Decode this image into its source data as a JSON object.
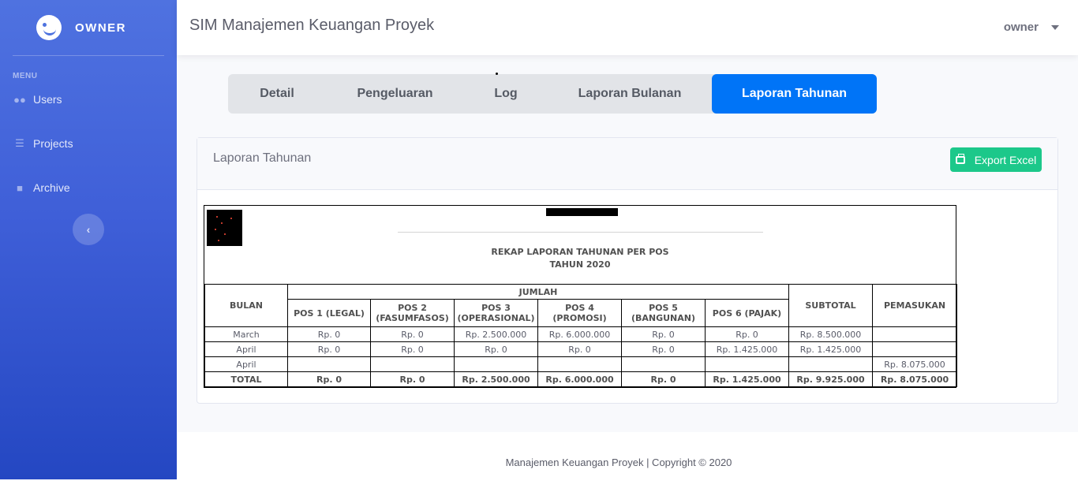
{
  "brand": {
    "name": "OWNER",
    "icon": "smile-wink-icon"
  },
  "sidebar": {
    "heading": "MENU",
    "items": [
      {
        "label": "Users",
        "icon": "users-icon"
      },
      {
        "label": "Projects",
        "icon": "tasks-icon"
      },
      {
        "label": "Archive",
        "icon": "book-icon"
      }
    ],
    "collapse_glyph": "‹"
  },
  "topbar": {
    "title": "SIM Manajemen Keuangan Proyek",
    "user": "owner"
  },
  "tabs": [
    {
      "label": "Detail"
    },
    {
      "label": "Pengeluaran"
    },
    {
      "label": "Log"
    },
    {
      "label": "Laporan Bulanan"
    },
    {
      "label": "Laporan Tahunan",
      "active": true
    }
  ],
  "card": {
    "title": "Laporan Tahunan",
    "export_label": "Export Excel"
  },
  "report": {
    "title_line1": "REKAP LAPORAN TAHUNAN PER POS",
    "title_line2": "TAHUN 2020",
    "headers": {
      "bulan": "BULAN",
      "jumlah": "JUMLAH",
      "pos": [
        "POS 1 (LEGAL)",
        "POS 2 (FASUMFASOS)",
        "POS 3 (OPERASIONAL)",
        "POS 4 (PROMOSI)",
        "POS 5 (BANGUNAN)",
        "POS 6 (PAJAK)"
      ],
      "subtotal": "SUBTOTAL",
      "pemasukan": "PEMASUKAN"
    },
    "rows": [
      [
        "March",
        "Rp. 0",
        "Rp. 0",
        "Rp. 2.500.000",
        "Rp. 6.000.000",
        "Rp. 0",
        "Rp. 0",
        "Rp. 8.500.000",
        ""
      ],
      [
        "April",
        "Rp. 0",
        "Rp. 0",
        "Rp. 0",
        "Rp. 0",
        "Rp. 0",
        "Rp. 1.425.000",
        "Rp. 1.425.000",
        ""
      ],
      [
        "April",
        "",
        "",
        "",
        "",
        "",
        "",
        "",
        "Rp. 8.075.000"
      ]
    ],
    "total": [
      "TOTAL",
      "Rp. 0",
      "Rp. 0",
      "Rp. 2.500.000",
      "Rp. 6.000.000",
      "Rp. 0",
      "Rp. 1.425.000",
      "Rp. 9.925.000",
      "Rp. 8.075.000"
    ]
  },
  "footer": {
    "text": "Manajemen Keuangan Proyek | Copyright © 2020"
  },
  "colors": {
    "accent": "#0074f7",
    "sidebar": "#4e73df",
    "success": "#1cc88a"
  }
}
